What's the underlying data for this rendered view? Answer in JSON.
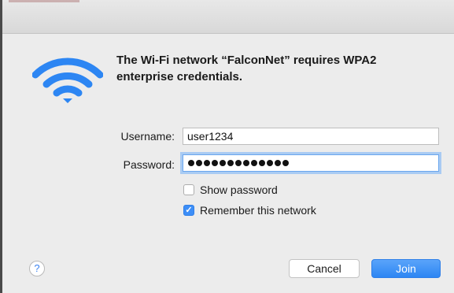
{
  "dialog": {
    "message": "The Wi-Fi network “FalconNet” requires WPA2 enterprise credentials.",
    "icon": "wifi-icon",
    "accent_color": "#2d86f3"
  },
  "form": {
    "username_label": "Username:",
    "username_value": "user1234",
    "password_label": "Password:",
    "password_mask_count": 13
  },
  "options": {
    "show_password_label": "Show password",
    "show_password_checked": false,
    "remember_label": "Remember this network",
    "remember_checked": true
  },
  "buttons": {
    "help_label": "?",
    "cancel_label": "Cancel",
    "join_label": "Join"
  }
}
